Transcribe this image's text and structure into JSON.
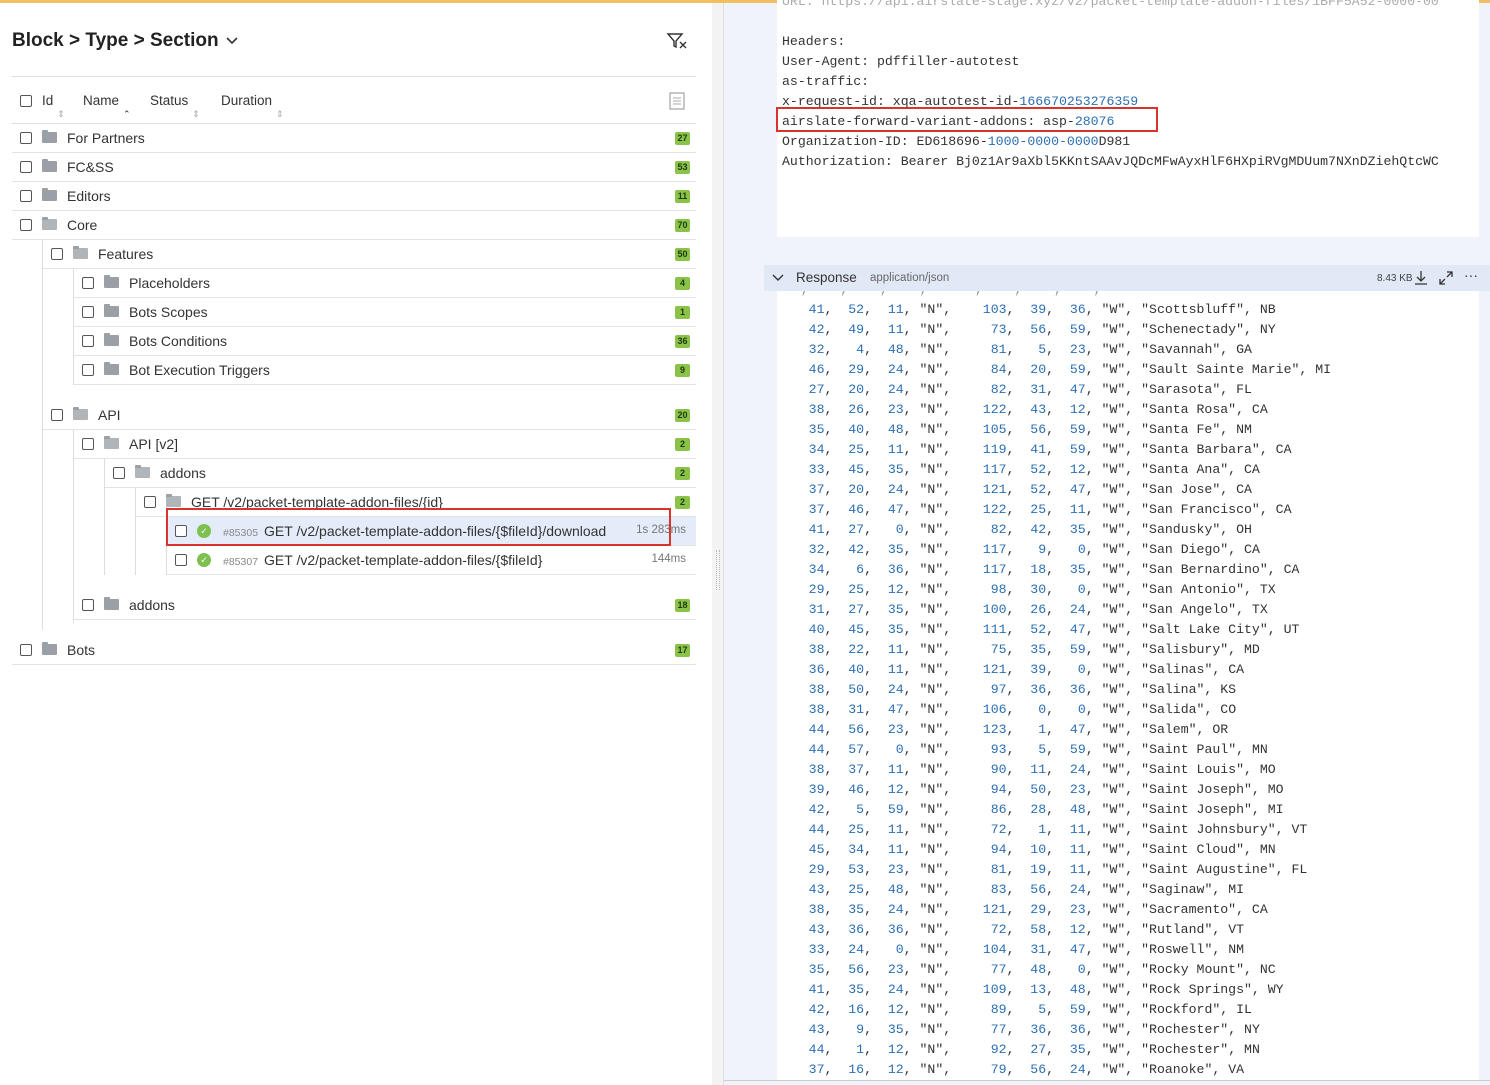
{
  "header": {
    "breadcrumb": "Block > Type > Section",
    "filter_icon": "filter-clear-icon"
  },
  "columns": [
    "Id",
    "Name",
    "Status",
    "Duration"
  ],
  "tree": [
    {
      "label": "For Partners",
      "count": "27",
      "level": 0
    },
    {
      "label": "FC&SS",
      "count": "53",
      "level": 0
    },
    {
      "label": "Editors",
      "count": "11",
      "level": 0
    },
    {
      "label": "Core",
      "count": "70",
      "level": 0,
      "open": true
    },
    {
      "label": "Features",
      "count": "50",
      "level": 1,
      "open": true
    },
    {
      "label": "Placeholders",
      "count": "4",
      "level": 2
    },
    {
      "label": "Bots Scopes",
      "count": "1",
      "level": 2
    },
    {
      "label": "Bots Conditions",
      "count": "36",
      "level": 2
    },
    {
      "label": "Bot Execution Triggers",
      "count": "9",
      "level": 2
    },
    {
      "label": "API",
      "count": "20",
      "level": 1,
      "open": true
    },
    {
      "label": "API [v2]",
      "count": "2",
      "level": 2,
      "open": true
    },
    {
      "label": "addons",
      "count": "2",
      "level": 3,
      "open": true
    },
    {
      "label": "GET /v2/packet-template-addon-files/{id}",
      "count": "2",
      "level": 4,
      "open": true
    },
    {
      "test": true,
      "id": "#85305",
      "label": "GET /v2/packet-template-addon-files/{$fileId}/download",
      "duration": "1s 283ms",
      "status": "passed",
      "selected": true
    },
    {
      "test": true,
      "id": "#85307",
      "label": "GET /v2/packet-template-addon-files/{$fileId}",
      "duration": "144ms",
      "status": "passed"
    },
    {
      "label": "addons",
      "count": "18",
      "level": 2
    },
    {
      "label": "Bots",
      "count": "17",
      "level": 0
    }
  ],
  "request": {
    "lines": [
      [
        [
          "URL: https://api.airslate-stage.xyz/v2/packet-template-addon-files/1BFF5A52-0000-00",
          ""
        ]
      ],
      [
        [
          "",
          ""
        ]
      ],
      [
        [
          "Headers:",
          ""
        ]
      ],
      [
        [
          "User-Agent: pdffiller-autotest",
          ""
        ]
      ],
      [
        [
          "as-traffic:",
          ""
        ]
      ],
      [
        [
          "x-request-id: xqa-autotest-id-",
          ""
        ],
        [
          "166670253276359",
          "num"
        ]
      ],
      [
        [
          "airslate-forward-variant-addons: asp-",
          ""
        ],
        [
          "28076",
          "num"
        ]
      ],
      [
        [
          "Organization-ID: ED618696-",
          ""
        ],
        [
          "1000-0000-0000",
          "num"
        ],
        [
          "D981",
          ""
        ]
      ],
      [
        [
          "Authorization: Bearer Bj0z1Ar9aXbl5KKntSAAvJQDcMFwAyxHlF6HXpiRVgMDUum7NXnDZiehQtcWC",
          ""
        ]
      ]
    ]
  },
  "response": {
    "label": "Response",
    "content_type": "application/json",
    "size": "8.43 KB",
    "rows": [
      [
        41,
        52,
        11,
        "N",
        103,
        39,
        36,
        "W",
        "Scottsbluff",
        "NB"
      ],
      [
        42,
        49,
        11,
        "N",
        73,
        56,
        59,
        "W",
        "Schenectady",
        "NY"
      ],
      [
        32,
        4,
        48,
        "N",
        81,
        5,
        23,
        "W",
        "Savannah",
        "GA"
      ],
      [
        46,
        29,
        24,
        "N",
        84,
        20,
        59,
        "W",
        "Sault Sainte Marie",
        "MI"
      ],
      [
        27,
        20,
        24,
        "N",
        82,
        31,
        47,
        "W",
        "Sarasota",
        "FL"
      ],
      [
        38,
        26,
        23,
        "N",
        122,
        43,
        12,
        "W",
        "Santa Rosa",
        "CA"
      ],
      [
        35,
        40,
        48,
        "N",
        105,
        56,
        59,
        "W",
        "Santa Fe",
        "NM"
      ],
      [
        34,
        25,
        11,
        "N",
        119,
        41,
        59,
        "W",
        "Santa Barbara",
        "CA"
      ],
      [
        33,
        45,
        35,
        "N",
        117,
        52,
        12,
        "W",
        "Santa Ana",
        "CA"
      ],
      [
        37,
        20,
        24,
        "N",
        121,
        52,
        47,
        "W",
        "San Jose",
        "CA"
      ],
      [
        37,
        46,
        47,
        "N",
        122,
        25,
        11,
        "W",
        "San Francisco",
        "CA"
      ],
      [
        41,
        27,
        0,
        "N",
        82,
        42,
        35,
        "W",
        "Sandusky",
        "OH"
      ],
      [
        32,
        42,
        35,
        "N",
        117,
        9,
        0,
        "W",
        "San Diego",
        "CA"
      ],
      [
        34,
        6,
        36,
        "N",
        117,
        18,
        35,
        "W",
        "San Bernardino",
        "CA"
      ],
      [
        29,
        25,
        12,
        "N",
        98,
        30,
        0,
        "W",
        "San Antonio",
        "TX"
      ],
      [
        31,
        27,
        35,
        "N",
        100,
        26,
        24,
        "W",
        "San Angelo",
        "TX"
      ],
      [
        40,
        45,
        35,
        "N",
        111,
        52,
        47,
        "W",
        "Salt Lake City",
        "UT"
      ],
      [
        38,
        22,
        11,
        "N",
        75,
        35,
        59,
        "W",
        "Salisbury",
        "MD"
      ],
      [
        36,
        40,
        11,
        "N",
        121,
        39,
        0,
        "W",
        "Salinas",
        "CA"
      ],
      [
        38,
        50,
        24,
        "N",
        97,
        36,
        36,
        "W",
        "Salina",
        "KS"
      ],
      [
        38,
        31,
        47,
        "N",
        106,
        0,
        0,
        "W",
        "Salida",
        "CO"
      ],
      [
        44,
        56,
        23,
        "N",
        123,
        1,
        47,
        "W",
        "Salem",
        "OR"
      ],
      [
        44,
        57,
        0,
        "N",
        93,
        5,
        59,
        "W",
        "Saint Paul",
        "MN"
      ],
      [
        38,
        37,
        11,
        "N",
        90,
        11,
        24,
        "W",
        "Saint Louis",
        "MO"
      ],
      [
        39,
        46,
        12,
        "N",
        94,
        50,
        23,
        "W",
        "Saint Joseph",
        "MO"
      ],
      [
        42,
        5,
        59,
        "N",
        86,
        28,
        48,
        "W",
        "Saint Joseph",
        "MI"
      ],
      [
        44,
        25,
        11,
        "N",
        72,
        1,
        11,
        "W",
        "Saint Johnsbury",
        "VT"
      ],
      [
        45,
        34,
        11,
        "N",
        94,
        10,
        11,
        "W",
        "Saint Cloud",
        "MN"
      ],
      [
        29,
        53,
        23,
        "N",
        81,
        19,
        11,
        "W",
        "Saint Augustine",
        "FL"
      ],
      [
        43,
        25,
        48,
        "N",
        83,
        56,
        24,
        "W",
        "Saginaw",
        "MI"
      ],
      [
        38,
        35,
        24,
        "N",
        121,
        29,
        23,
        "W",
        "Sacramento",
        "CA"
      ],
      [
        43,
        36,
        36,
        "N",
        72,
        58,
        12,
        "W",
        "Rutland",
        "VT"
      ],
      [
        33,
        24,
        0,
        "N",
        104,
        31,
        47,
        "W",
        "Roswell",
        "NM"
      ],
      [
        35,
        56,
        23,
        "N",
        77,
        48,
        0,
        "W",
        "Rocky Mount",
        "NC"
      ],
      [
        41,
        35,
        24,
        "N",
        109,
        13,
        48,
        "W",
        "Rock Springs",
        "WY"
      ],
      [
        42,
        16,
        12,
        "N",
        89,
        5,
        59,
        "W",
        "Rockford",
        "IL"
      ],
      [
        43,
        9,
        35,
        "N",
        77,
        36,
        36,
        "W",
        "Rochester",
        "NY"
      ],
      [
        44,
        1,
        12,
        "N",
        92,
        27,
        35,
        "W",
        "Rochester",
        "MN"
      ],
      [
        37,
        16,
        12,
        "N",
        79,
        56,
        24,
        "W",
        "Roanoke",
        "VA"
      ]
    ]
  },
  "colors": {
    "accent_highlight": "#d9342b",
    "badge": "#8bc34a",
    "number": "#2c6fb3",
    "top_bar": "#f0c060"
  }
}
